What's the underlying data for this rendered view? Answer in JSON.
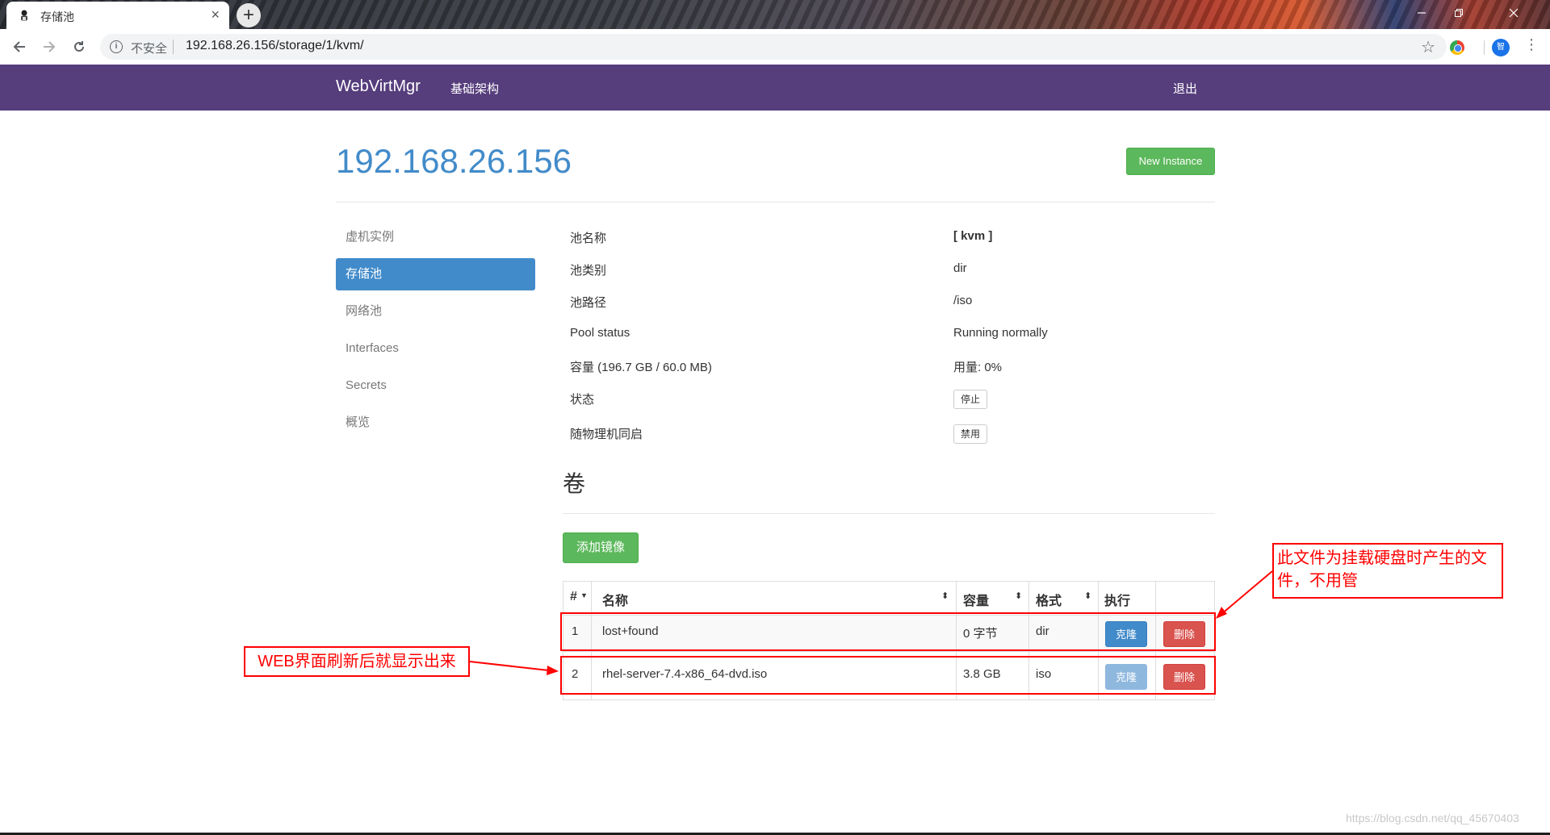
{
  "browser": {
    "tab_title": "存储池",
    "tab_close": "×",
    "new_tab": "+",
    "security_label": "不安全",
    "url": "192.168.26.156/storage/1/kvm/",
    "profile_initial": "智"
  },
  "navbar": {
    "brand": "WebVirtMgr",
    "infrastructure": "基础架构",
    "logout": "退出",
    "color": "#563d7c"
  },
  "page": {
    "host_title": "192.168.26.156",
    "new_instance_label": "New Instance"
  },
  "sidebar": {
    "items": [
      {
        "label": "虚机实例",
        "active": false
      },
      {
        "label": "存储池",
        "active": true
      },
      {
        "label": "网络池",
        "active": false
      },
      {
        "label": "Interfaces",
        "active": false
      },
      {
        "label": "Secrets",
        "active": false
      },
      {
        "label": "概览",
        "active": false
      }
    ]
  },
  "pool_info": {
    "name_label": "池名称",
    "name_value": "[ kvm ]",
    "type_label": "池类别",
    "type_value": "dir",
    "path_label": "池路径",
    "path_value": "/iso",
    "status_label": "Pool status",
    "status_value": "Running normally",
    "capacity_label": "容量 (196.7 GB / 60.0 MB)",
    "usage_value": "用量: 0%",
    "state_label": "状态",
    "stop_button": "停止",
    "autostart_label": "随物理机同启",
    "disable_button": "禁用"
  },
  "volumes": {
    "heading": "卷",
    "add_image_label": "添加镜像",
    "columns": [
      "#",
      "名称",
      "容量",
      "格式",
      "执行"
    ],
    "clone_label": "克隆",
    "delete_label": "删除",
    "rows": [
      {
        "num": "1",
        "name": "lost+found",
        "size": "0 字节",
        "format": "dir"
      },
      {
        "num": "2",
        "name": "rhel-server-7.4-x86_64-dvd.iso",
        "size": "3.8 GB",
        "format": "iso"
      }
    ]
  },
  "annotations": {
    "note_row1": "此文件为挂载硬盘时产生的文件，不用管",
    "note_row2": "WEB界面刷新后就显示出来",
    "color": "#ff0000"
  },
  "watermark": "https://blog.csdn.net/qq_45670403"
}
